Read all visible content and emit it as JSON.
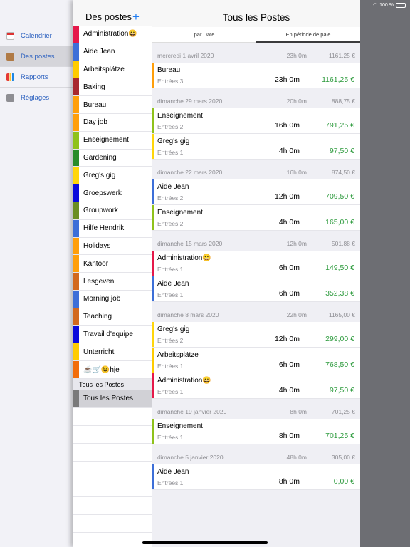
{
  "status": {
    "battery": "100 %"
  },
  "nav": {
    "items": [
      {
        "label": "Calendrier",
        "icon": "calendar-icon"
      },
      {
        "label": "Des postes",
        "icon": "box-icon",
        "active": true
      },
      {
        "label": "Rapports",
        "icon": "chart-icon"
      },
      {
        "label": "Réglages",
        "icon": "gear-icon"
      }
    ]
  },
  "postes": {
    "title": "Des postes",
    "add": "+",
    "items": [
      {
        "label": "Administration😀",
        "color": "#e5194a"
      },
      {
        "label": "Aide Jean",
        "color": "#3d6fd8"
      },
      {
        "label": "Arbeitsplätze",
        "color": "#ffcc00"
      },
      {
        "label": "Baking",
        "color": "#a8282e"
      },
      {
        "label": "Bureau",
        "color": "#ff9f0a"
      },
      {
        "label": "Day job",
        "color": "#ff9f0a"
      },
      {
        "label": "Enseignement",
        "color": "#8fc21b"
      },
      {
        "label": "Gardening",
        "color": "#2a8c2a"
      },
      {
        "label": "Greg's gig",
        "color": "#ffd60a"
      },
      {
        "label": "Groepswerk",
        "color": "#0a0adc"
      },
      {
        "label": "Groupwork",
        "color": "#6b8e23"
      },
      {
        "label": "Hilfe Hendrik",
        "color": "#3d6fd8"
      },
      {
        "label": "Holidays",
        "color": "#ff9f0a"
      },
      {
        "label": "Kantoor",
        "color": "#ff9f0a"
      },
      {
        "label": "Lesgeven",
        "color": "#d2691e"
      },
      {
        "label": "Morning job",
        "color": "#3d6fd8"
      },
      {
        "label": "Teaching",
        "color": "#d2691e"
      },
      {
        "label": "Travail d'equipe",
        "color": "#0a0adc"
      },
      {
        "label": "Unterricht",
        "color": "#ffcc00"
      },
      {
        "label": "☕️🛒😉hje",
        "color": "#f26d0a"
      }
    ],
    "section": "Tous les Postes",
    "all": {
      "label": "Tous les Postes",
      "color": "#7a7a7a"
    }
  },
  "main": {
    "title": "Tous les Postes",
    "tabs": [
      {
        "label": "par Date"
      },
      {
        "label": "En période de paie",
        "active": true
      }
    ],
    "groups": [
      {
        "date": "mercredi 1 avril 2020",
        "hours": "23h 0m",
        "amount": "1161,25 €",
        "entries": [
          {
            "name": "Bureau",
            "sub": "Entrées 3",
            "hours": "23h 0m",
            "amount": "1161,25 €",
            "color": "#ff9f0a"
          }
        ]
      },
      {
        "date": "dimanche 29 mars 2020",
        "hours": "20h 0m",
        "amount": "888,75 €",
        "entries": [
          {
            "name": "Enseignement",
            "sub": "Entrées 2",
            "hours": "16h 0m",
            "amount": "791,25 €",
            "color": "#8fc21b"
          },
          {
            "name": "Greg's gig",
            "sub": "Entrées 1",
            "hours": "4h 0m",
            "amount": "97,50 €",
            "color": "#ffd60a"
          }
        ]
      },
      {
        "date": "dimanche 22 mars 2020",
        "hours": "16h 0m",
        "amount": "874,50 €",
        "entries": [
          {
            "name": "Aide Jean",
            "sub": "Entrées 2",
            "hours": "12h 0m",
            "amount": "709,50 €",
            "color": "#3d6fd8"
          },
          {
            "name": "Enseignement",
            "sub": "Entrées 2",
            "hours": "4h 0m",
            "amount": "165,00 €",
            "color": "#8fc21b"
          }
        ]
      },
      {
        "date": "dimanche 15 mars 2020",
        "hours": "12h 0m",
        "amount": "501,88 €",
        "entries": [
          {
            "name": "Administration😀",
            "sub": "Entrées 1",
            "hours": "6h 0m",
            "amount": "149,50 €",
            "color": "#e5194a"
          },
          {
            "name": "Aide Jean",
            "sub": "Entrées 1",
            "hours": "6h 0m",
            "amount": "352,38 €",
            "color": "#3d6fd8"
          }
        ]
      },
      {
        "date": "dimanche 8 mars 2020",
        "hours": "22h 0m",
        "amount": "1165,00 €",
        "entries": [
          {
            "name": "Greg's gig",
            "sub": "Entrées 2",
            "hours": "12h 0m",
            "amount": "299,00 €",
            "color": "#ffd60a"
          },
          {
            "name": "Arbeitsplätze",
            "sub": "Entrées 1",
            "hours": "6h 0m",
            "amount": "768,50 €",
            "color": "#ffcc00"
          },
          {
            "name": "Administration😀",
            "sub": "Entrées 1",
            "hours": "4h 0m",
            "amount": "97,50 €",
            "color": "#e5194a"
          }
        ]
      },
      {
        "date": "dimanche 19 janvier 2020",
        "hours": "8h 0m",
        "amount": "701,25 €",
        "entries": [
          {
            "name": "Enseignement",
            "sub": "Entrées 1",
            "hours": "8h 0m",
            "amount": "701,25 €",
            "color": "#8fc21b"
          }
        ]
      },
      {
        "date": "dimanche 5 janvier 2020",
        "hours": "48h 0m",
        "amount": "305,00 €",
        "entries": [
          {
            "name": "Aide Jean",
            "sub": "Entrées 1",
            "hours": "8h 0m",
            "amount": "0,00 €",
            "color": "#3d6fd8"
          }
        ]
      }
    ]
  }
}
